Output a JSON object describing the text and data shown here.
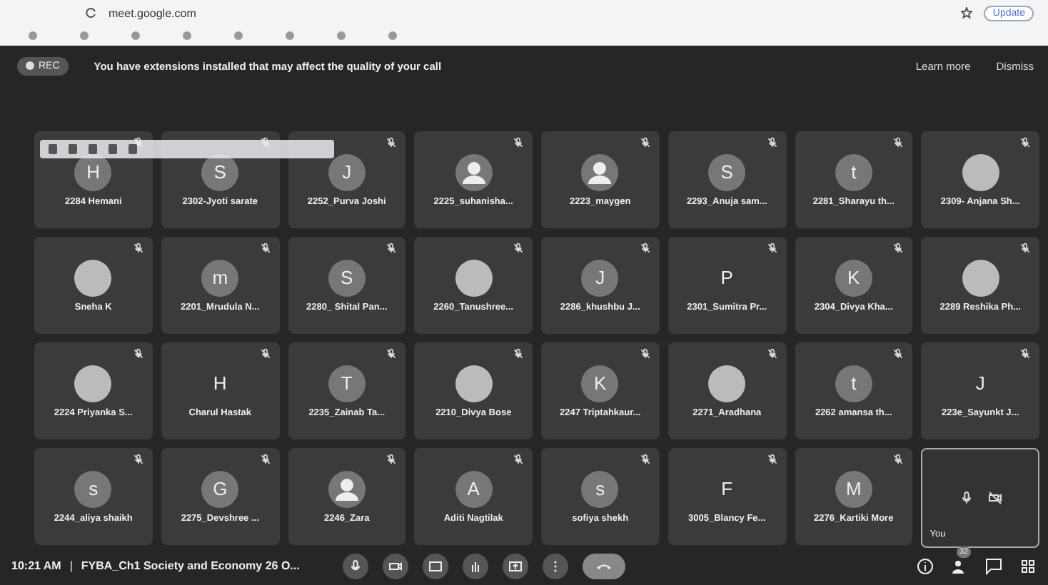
{
  "browser": {
    "url": "meet.google.com",
    "update_button": "Update"
  },
  "banner": {
    "rec_label": "REC",
    "message": "You have extensions installed that may affect the quality of your call",
    "learn_more": "Learn more",
    "dismiss": "Dismiss"
  },
  "tiles": [
    {
      "name": "2284 Hemani",
      "kind": "letter",
      "letter": "H"
    },
    {
      "name": "2302-Jyoti sarate",
      "kind": "letter",
      "letter": "S"
    },
    {
      "name": "2252_Purva Joshi",
      "kind": "letter",
      "letter": "J"
    },
    {
      "name": "2225_suhanisha...",
      "kind": "silhouette"
    },
    {
      "name": "2223_maygen",
      "kind": "silhouette"
    },
    {
      "name": "2293_Anuja sam...",
      "kind": "letter",
      "letter": "S"
    },
    {
      "name": "2281_Sharayu th...",
      "kind": "letter",
      "letter": "t"
    },
    {
      "name": "2309- Anjana Sh...",
      "kind": "photo"
    },
    {
      "name": "Sneha K",
      "kind": "photo"
    },
    {
      "name": "2201_Mrudula N...",
      "kind": "letter",
      "letter": "m"
    },
    {
      "name": "2280_ Shital Pan...",
      "kind": "letter",
      "letter": "S"
    },
    {
      "name": "2260_Tanushree...",
      "kind": "photo"
    },
    {
      "name": "2286_khushbu J...",
      "kind": "letter",
      "letter": "J"
    },
    {
      "name": "2301_Sumitra Pr...",
      "kind": "plain",
      "letter": "P"
    },
    {
      "name": "2304_Divya Kha...",
      "kind": "letter",
      "letter": "K"
    },
    {
      "name": "2289 Reshika Ph...",
      "kind": "photo"
    },
    {
      "name": "2224 Priyanka S...",
      "kind": "photo"
    },
    {
      "name": "Charul Hastak",
      "kind": "plain",
      "letter": "H"
    },
    {
      "name": "2235_Zainab Ta...",
      "kind": "letter",
      "letter": "T"
    },
    {
      "name": "2210_Divya Bose",
      "kind": "photo"
    },
    {
      "name": "2247 Triptahkaur...",
      "kind": "letter",
      "letter": "K"
    },
    {
      "name": "2271_Aradhana",
      "kind": "photo"
    },
    {
      "name": "2262 amansa th...",
      "kind": "letter",
      "letter": "t"
    },
    {
      "name": "223e_Sayunkt J...",
      "kind": "plain",
      "letter": "J"
    },
    {
      "name": "2244_aliya shaikh",
      "kind": "letter",
      "letter": "s"
    },
    {
      "name": "2275_Devshree ...",
      "kind": "letter",
      "letter": "G"
    },
    {
      "name": "2246_Zara",
      "kind": "silhouette"
    },
    {
      "name": "Aditi Nagtilak",
      "kind": "letter",
      "letter": "A"
    },
    {
      "name": "sofiya shekh",
      "kind": "letter",
      "letter": "s"
    },
    {
      "name": "3005_Blancy Fe...",
      "kind": "plain",
      "letter": "F"
    },
    {
      "name": "2276_Kartiki More",
      "kind": "letter",
      "letter": "M"
    }
  ],
  "self_tile": {
    "name": "You"
  },
  "bottom_bar": {
    "time": "10:21 AM",
    "separator": "|",
    "meeting_title": "FYBA_Ch1 Society and Economy 26 O...",
    "people_count": "32"
  }
}
